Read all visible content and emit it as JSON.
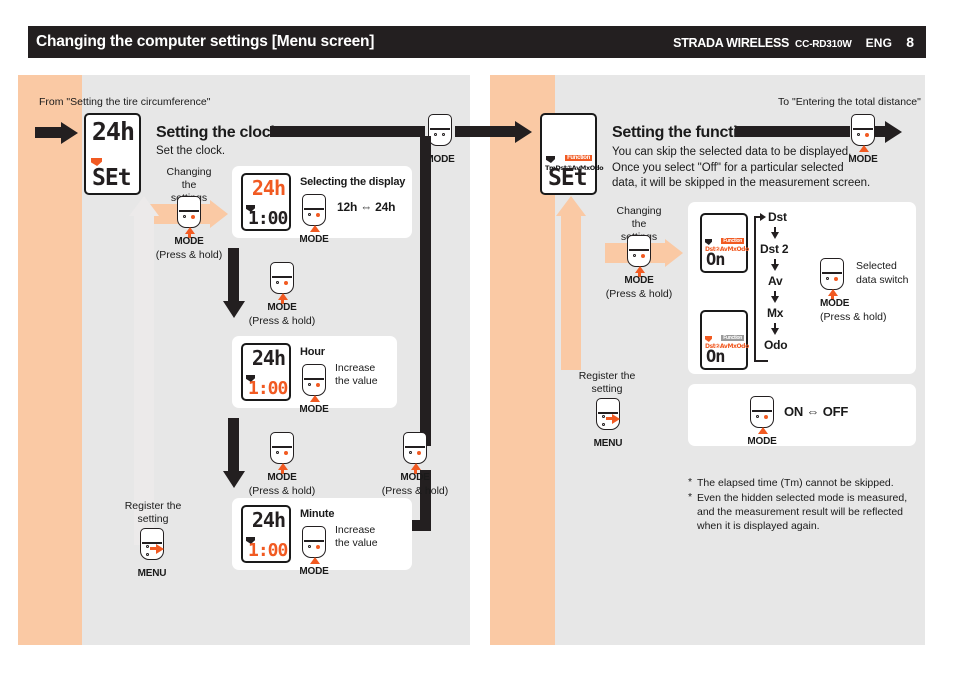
{
  "header": {
    "title": "Changing the computer settings [Menu screen]",
    "brand": "STRADA WIRELESS",
    "model": "CC-RD310W",
    "language": "ENG",
    "page_number": "8"
  },
  "left": {
    "from_label": "From \"Setting the tire circumference\"",
    "section_title": "Setting the clock",
    "section_sub": "Set the clock.",
    "start_lcd": {
      "top": "24h",
      "bottom": "SEt"
    },
    "changing": {
      "line1": "Changing the",
      "line2": "settings",
      "button": "MODE",
      "hint": "(Press & hold)"
    },
    "steps": [
      {
        "name": "display",
        "title": "Selecting the display",
        "value": "12h ⇔ 24h",
        "button": "MODE",
        "lcd": {
          "top": "24h",
          "top_color": "#f15a22",
          "bottom": "1:00",
          "bottom_color": "#231f20"
        }
      },
      {
        "name": "hour",
        "title": "Hour",
        "value_line1": "Increase",
        "value_line2": "the value",
        "button": "MODE",
        "lcd": {
          "top": "24h",
          "top_color": "#231f20",
          "bottom": "1:00",
          "bottom_color": "#f15a22"
        }
      },
      {
        "name": "minute",
        "title": "Minute",
        "value_line1": "Increase",
        "value_line2": "the value",
        "button": "MODE",
        "lcd": {
          "top": "24h",
          "top_color": "#231f20",
          "bottom": "1:00",
          "bottom_color": "#f15a22"
        }
      }
    ],
    "transitions": [
      {
        "button": "MODE",
        "hint": "(Press & hold)"
      },
      {
        "button": "MODE",
        "hint": "(Press & hold)"
      },
      {
        "button": "MODE",
        "hint": "(Press & hold)"
      }
    ],
    "register": {
      "line1": "Register the",
      "line2": "setting",
      "button": "MENU"
    },
    "top_mode": "MODE"
  },
  "right": {
    "to_label": "To \"Entering the total distance\"",
    "section_title": "Setting the function",
    "section_sub_lines": [
      "You can skip the selected data to be displayed.",
      "Once you select \"Off\" for a particular selected",
      "data, it will be skipped in the measurement screen."
    ],
    "top_mode": "MODE",
    "start_lcd": {
      "badge": "Function",
      "segments": "TmDst②AvMxOdo",
      "bottom": "SEt"
    },
    "changing": {
      "line1": "Changing the",
      "line2": "settings",
      "button": "MODE",
      "hint": "(Press & hold)"
    },
    "state_lcd": {
      "segments": "Dst②AvMxOdo",
      "bottom": "On"
    },
    "flow_items": [
      "Dst",
      "Dst 2",
      "Av",
      "Mx",
      "Odo"
    ],
    "flow_end_icon": "pace-arrow-icon",
    "switch": {
      "line1": "Selected",
      "line2": "data switch",
      "button": "MODE",
      "hint": "(Press & hold)"
    },
    "onoff": {
      "value": "ON ⇔ OFF",
      "button": "MODE"
    },
    "register": {
      "line1": "Register the",
      "line2": "setting",
      "button": "MENU"
    },
    "footnotes": [
      "The elapsed time (Tm) cannot be skipped.",
      "Even the hidden selected mode is measured,",
      "and the measurement result will be reflected",
      "when it is displayed again."
    ]
  },
  "colors": {
    "orange": "#f15a22",
    "band": "#fac9a4",
    "gray": "#e7e7e7",
    "black": "#231f20"
  }
}
